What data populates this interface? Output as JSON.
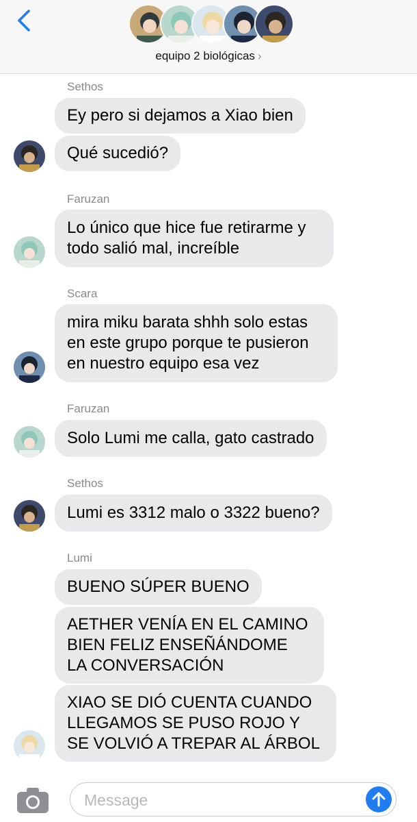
{
  "header": {
    "group_name": "equipo 2 biológicas",
    "chevron": "›"
  },
  "colors": {
    "accent": "#1f7cf1",
    "bubble": "#e9e9eb",
    "sender_text": "#8a8a8e"
  },
  "messages": [
    {
      "sender": "Sethos",
      "text": "Ey pero si dejamos a Xiao bien"
    },
    {
      "text": "Qué sucedió?"
    },
    {
      "sender": "Faruzan",
      "text": "Lo único que hice fue retirarme y todo salió mal, increíble"
    },
    {
      "sender": "Scara",
      "text": "mira miku barata shhh solo estas en este grupo porque te pusieron en nuestro equipo esa vez"
    },
    {
      "sender": "Faruzan",
      "text": "Solo Lumi me calla, gato castrado"
    },
    {
      "sender": "Sethos",
      "text": "Lumi es 3312 malo o 3322 bueno?"
    },
    {
      "sender": "Lumi",
      "text": "BUENO SÚPER BUENO"
    },
    {
      "text": "AETHER VENÍA EN EL CAMINO BIEN FELIZ ENSEÑÁNDOME LA CONVERSACIÓN"
    },
    {
      "text": "XIAO SE DIÓ CUENTA CUANDO LLEGAMOS SE PUSO ROJO Y SE VOLVIÓ A TREPAR AL ÁRBOL"
    }
  ],
  "composer": {
    "placeholder": "Message"
  },
  "icons": [
    "back-chevron-icon",
    "camera-icon",
    "send-arrow-icon"
  ]
}
